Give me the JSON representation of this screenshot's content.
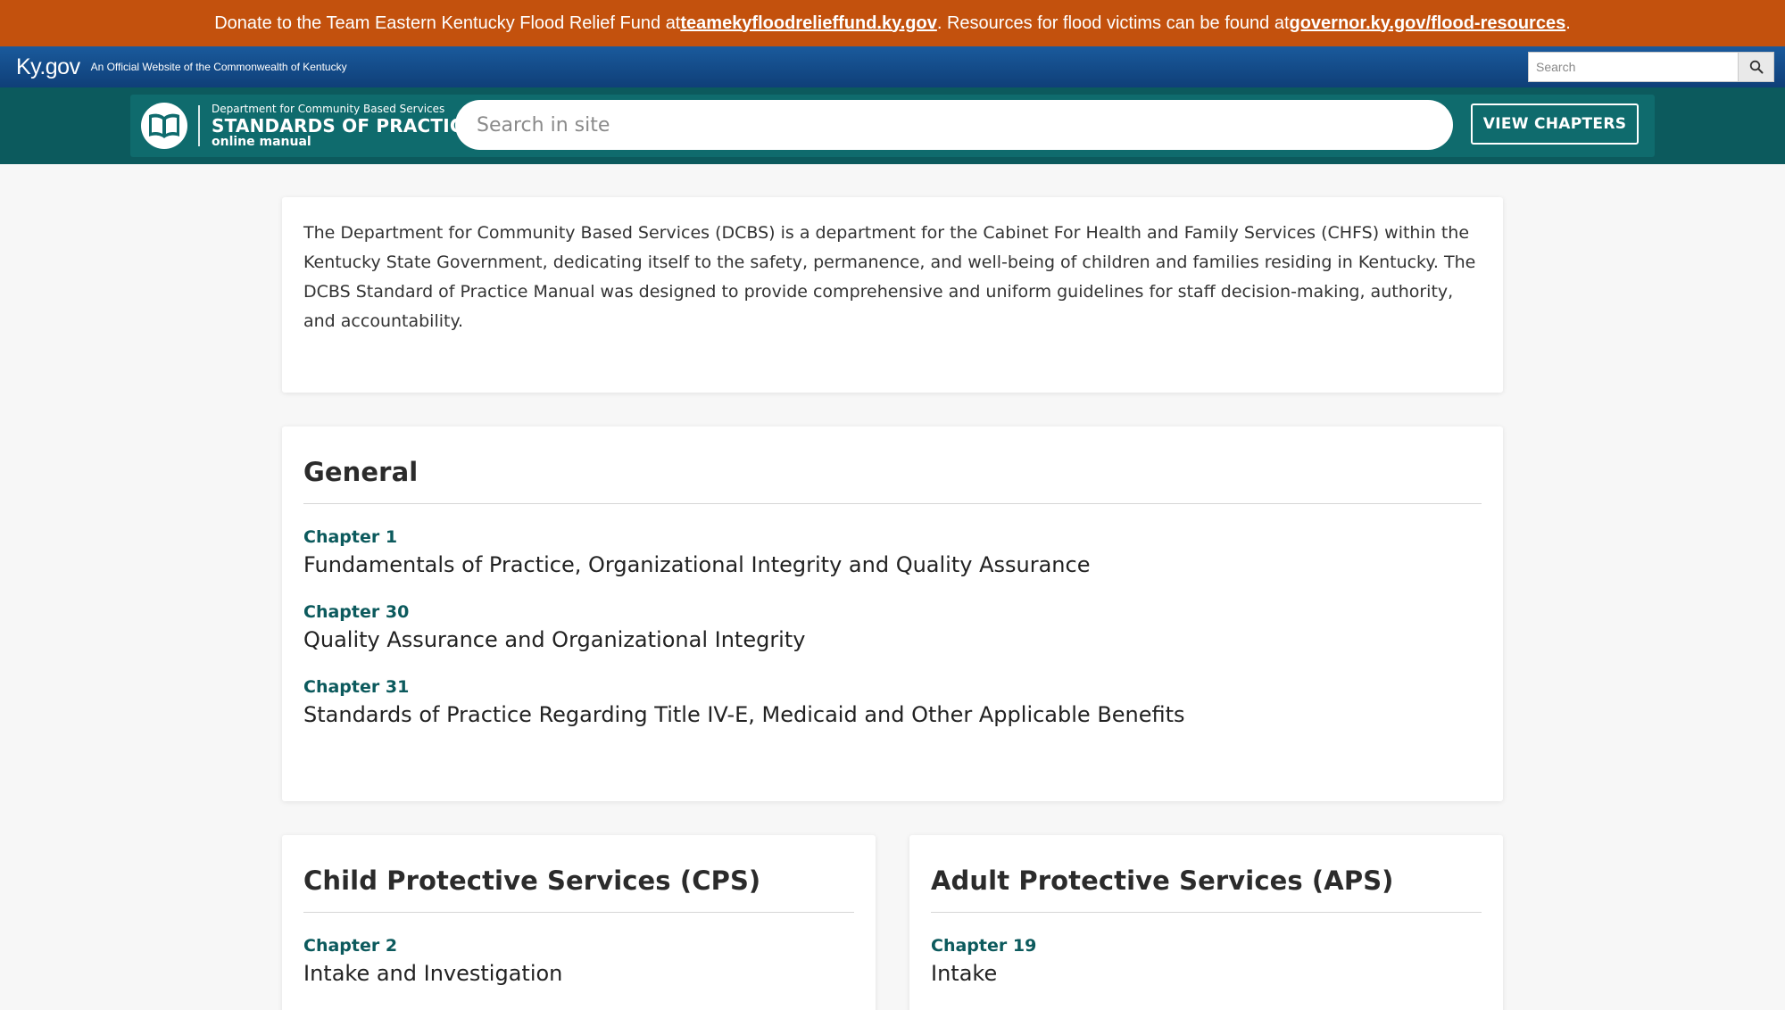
{
  "alert": {
    "text1": "Donate to the Team Eastern Kentucky Flood Relief Fund at ",
    "link1": "teamekyfloodrelieffund.ky.gov",
    "text2": ". Resources for flood victims can be found at ",
    "link2": "governor.ky.gov/flood-resources",
    "text3": "."
  },
  "kygov": {
    "logo": "Ky.gov",
    "tagline": "An Official Website of the Commonwealth of Kentucky",
    "search_placeholder": "Search"
  },
  "site": {
    "dept": "Department for Community Based Services",
    "title": "STANDARDS OF PRACTICE",
    "subtitle": "online manual",
    "search_placeholder": "Search in site",
    "view_chapters": "VIEW CHAPTERS"
  },
  "intro": {
    "text": "The Department for Community Based Services (DCBS) is a department for the Cabinet For Health and Family Services (CHFS) within the Kentucky State Government, dedicating itself to the safety, permanence, and well-being of children and families residing in Kentucky. The DCBS Standard of Practice Manual was designed to provide comprehensive and uniform guidelines for staff decision-making, authority, and accountability."
  },
  "sections": {
    "general": {
      "title": "General",
      "chapters": [
        {
          "num": "Chapter 1",
          "title": "Fundamentals of Practice, Organizational Integrity and Quality Assurance"
        },
        {
          "num": "Chapter 30",
          "title": "Quality Assurance and Organizational Integrity"
        },
        {
          "num": "Chapter 31",
          "title": "Standards of Practice Regarding Title IV-E, Medicaid and Other Applicable Benefits"
        }
      ]
    },
    "cps": {
      "title": "Child Protective Services (CPS)",
      "chapters": [
        {
          "num": "Chapter 2",
          "title": "Intake and Investigation"
        }
      ]
    },
    "aps": {
      "title": "Adult Protective Services (APS)",
      "chapters": [
        {
          "num": "Chapter 19",
          "title": "Intake"
        }
      ]
    }
  },
  "icons": {
    "kygov_search": "search-icon",
    "site_logo": "open-book-icon"
  },
  "colors": {
    "alert_bg": "#c3510d",
    "kygov_bar": "#12497f",
    "site_band": "#0c5a5d",
    "chapter_label": "#0c5a5d"
  }
}
